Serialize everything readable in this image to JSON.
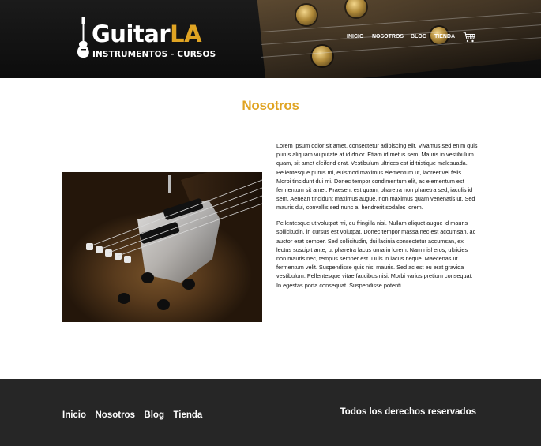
{
  "header": {
    "logo": {
      "main": "Guitar",
      "accent": "LA",
      "sub": "INSTRUMENTOS - CURSOS"
    },
    "nav": [
      {
        "label": "INICIO"
      },
      {
        "label": "NOSOTROS"
      },
      {
        "label": "BLOG"
      },
      {
        "label": "TIENDA"
      }
    ],
    "cart_icon": "cart-icon"
  },
  "main": {
    "title": "Nosotros",
    "image_icon": "electric-guitar-photo",
    "paragraphs": [
      "Lorem ipsum dolor sit amet, consectetur adipiscing elit. Vivamus sed enim quis purus aliquam vulputate at id dolor. Etiam id metus sem. Mauris in vestibulum quam, sit amet eleifend erat. Vestibulum ultrices est id tristique malesuada. Pellentesque purus mi, euismod maximus elementum ut, laoreet vel felis. Morbi tincidunt dui mi. Donec tempor condimentum elit, ac elementum est fermentum sit amet. Praesent est quam, pharetra non pharetra sed, iaculis id sem. Aenean tincidunt maximus augue, non maximus quam venenatis ut. Sed mauris dui, convallis sed nunc a, hendrerit sodales lorem.",
      "Pellentesque ut volutpat mi, eu fringilla nisi. Nullam aliquet augue id mauris sollicitudin, in cursus est volutpat. Donec tempor massa nec est accumsan, ac auctor erat semper. Sed sollicitudin, dui lacinia consectetur accumsan, ex lectus suscipit ante, ut pharetra lacus urna in lorem. Nam nisl eros, ultricies non mauris nec, tempus semper est. Duis in lacus neque. Maecenas ut fermentum velit. Suspendisse quis nisl mauris. Sed ac est eu erat gravida vestibulum. Pellentesque vitae faucibus nisi. Morbi varius pretium consequat. In egestas porta consequat. Suspendisse potenti."
    ]
  },
  "footer": {
    "nav": [
      {
        "label": "Inicio"
      },
      {
        "label": "Nosotros"
      },
      {
        "label": "Blog"
      },
      {
        "label": "Tienda"
      }
    ],
    "copyright": "Todos los derechos reservados"
  },
  "colors": {
    "accent": "#e0a423",
    "footer_bg": "#262626",
    "header_bg": "#0c0c0c"
  }
}
